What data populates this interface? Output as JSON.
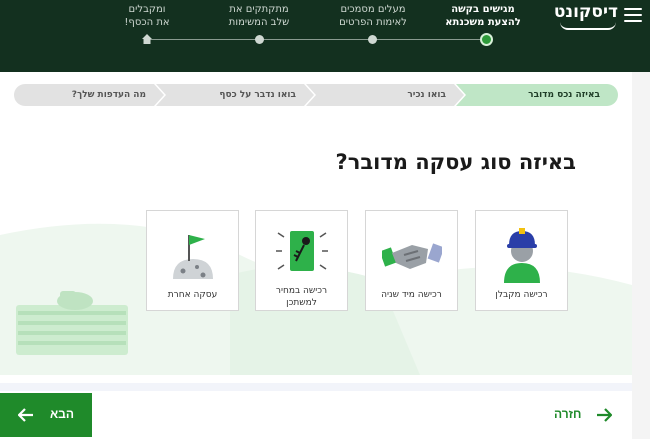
{
  "header": {
    "logo": "דיסקונט",
    "steps": [
      {
        "line1": "מגישים בקשה",
        "line2": "להצעת משכנתא",
        "active": true
      },
      {
        "line1": "מעלים מסמכים",
        "line2": "לאימות הפרטים",
        "active": false
      },
      {
        "line1": "מתקתקים את",
        "line2": "שלב המשימות",
        "active": false
      },
      {
        "line1": "ומקבלים",
        "line2": "את הכסף!",
        "active": false
      }
    ]
  },
  "tabs": [
    {
      "label": "באיזה נכס מדובר",
      "active": true
    },
    {
      "label": "בואו נכיר",
      "active": false
    },
    {
      "label": "בואו נדבר על כסף",
      "active": false
    },
    {
      "label": "מה העדפות שלך?",
      "active": false
    }
  ],
  "question": "באיזה סוג עסקה מדובר?",
  "cards": [
    {
      "label": "רכישה מקבלן",
      "icon": "worker-icon"
    },
    {
      "label": "רכישה מיד שניה",
      "icon": "handshake-icon"
    },
    {
      "label_line1": "רכישה במחיר",
      "label_line2": "למשתכן",
      "icon": "key-ticket-icon"
    },
    {
      "label": "עסקה אחרת",
      "icon": "flag-globe-icon"
    }
  ],
  "buttons": {
    "next": "הבא",
    "back": "חזרה"
  },
  "colors": {
    "header_bg": "#13301f",
    "accent": "#1f8a2a",
    "active_tab": "#bfe6c6"
  }
}
